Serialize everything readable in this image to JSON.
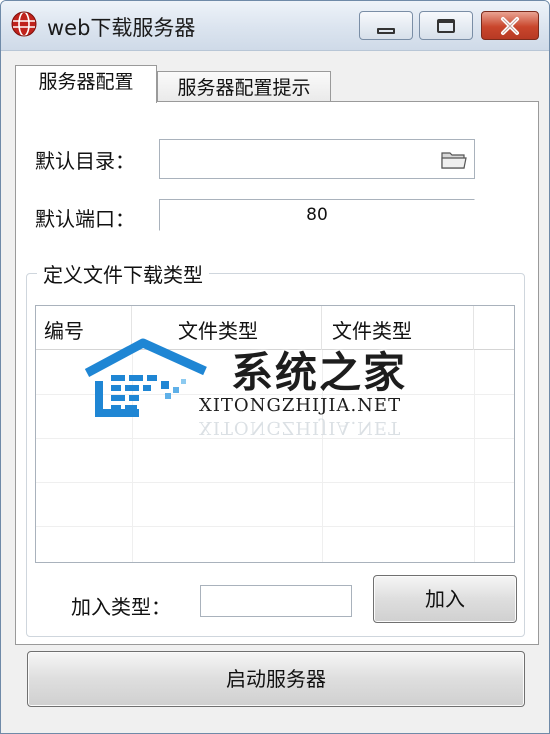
{
  "window": {
    "title": "web下载服务器",
    "app_icon": "globe-icon"
  },
  "tabs": [
    {
      "label": "服务器配置",
      "active": true
    },
    {
      "label": "服务器配置提示",
      "active": false
    }
  ],
  "config": {
    "dir_label": "默认目录：",
    "dir_value": "",
    "port_label": "默认端口：",
    "port_value": "80"
  },
  "file_types": {
    "group_title": "定义文件下载类型",
    "columns": [
      "编号",
      "文件类型",
      "文件类型"
    ],
    "rows": [],
    "add_label": "加入类型：",
    "add_value": "",
    "add_button": "加入"
  },
  "watermark": {
    "cn": "系统之家",
    "en": "XITONGZHIJIA.NET"
  },
  "start_button": "启动服务器",
  "colors": {
    "watermark_blue": "#1f86d4",
    "close_red": "#c9462c"
  }
}
